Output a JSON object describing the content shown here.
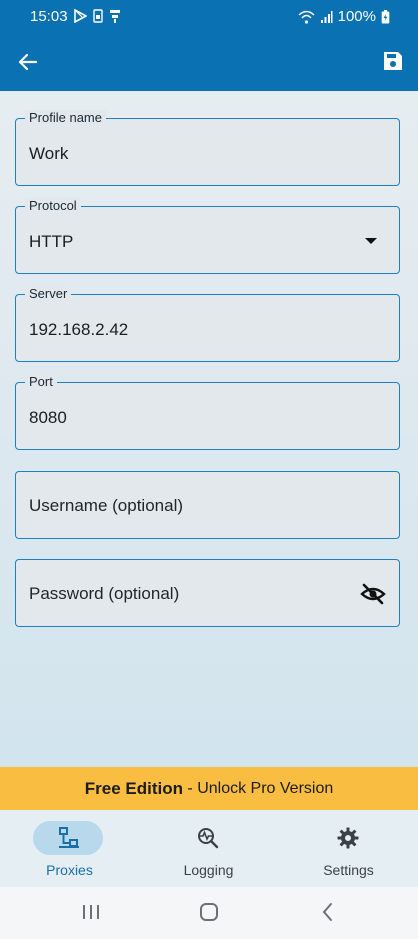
{
  "status_bar": {
    "time": "15:03",
    "battery": "100%",
    "icons": [
      "play-store-icon",
      "sim-icon",
      "vpn-key-icon",
      "wifi-icon",
      "signal-icon",
      "battery-charging-icon"
    ]
  },
  "app_bar": {
    "back_icon": "arrow-back-icon",
    "save_icon": "save-icon"
  },
  "form": {
    "profile_name": {
      "label": "Profile name",
      "value": "Work"
    },
    "protocol": {
      "label": "Protocol",
      "value": "HTTP"
    },
    "server": {
      "label": "Server",
      "value": "192.168.2.42"
    },
    "port": {
      "label": "Port",
      "value": "8080"
    },
    "username": {
      "placeholder": "Username (optional)"
    },
    "password": {
      "placeholder": "Password (optional)",
      "toggle_icon": "visibility-off-icon"
    }
  },
  "promo": {
    "bold": "Free Edition",
    "rest": " - Unlock Pro Version",
    "color": "#f9bd42"
  },
  "bottom_nav": {
    "items": [
      {
        "label": "Proxies",
        "icon": "proxies-icon",
        "active": true
      },
      {
        "label": "Logging",
        "icon": "logging-icon",
        "active": false
      },
      {
        "label": "Settings",
        "icon": "gear-icon",
        "active": false
      }
    ]
  },
  "colors": {
    "primary": "#0a72b3",
    "accent": "#1a6fa8",
    "field_border": "#1f7fbf"
  }
}
